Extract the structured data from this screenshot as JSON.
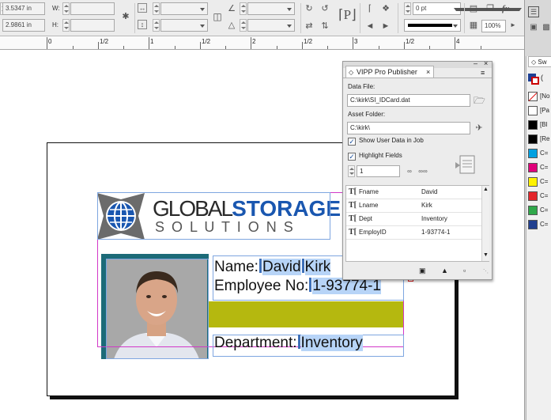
{
  "control_bar": {
    "x_value": "3.5347 in",
    "y_value": "2.9861 in",
    "w_label": "W:",
    "h_label": "H:",
    "stroke_weight": "0 pt",
    "zoom": "100%"
  },
  "ruler": {
    "labels": [
      "0",
      "1/2",
      "1",
      "1/2",
      "2",
      "1/2",
      "3",
      "1/2",
      "4"
    ]
  },
  "id_card": {
    "logo_global": "GLOBAL",
    "logo_storage": "STORAGE",
    "logo_solutions": "S O L U T I O N S",
    "name_label": "Name:",
    "first_name": "David",
    "last_name": "Kirk",
    "employee_label": "Employee No:",
    "employee_no": "1-93774-1",
    "department_label": "Department:",
    "department": "Inventory"
  },
  "vipp_panel": {
    "tab_title": "VIPP Pro Publisher",
    "data_file_label": "Data File:",
    "data_file_value": "C:\\kirk\\SI_IDCard.dat",
    "asset_folder_label": "Asset Folder:",
    "asset_folder_value": "C:\\kirk\\",
    "show_user_data_label": "Show User Data in Job",
    "highlight_fields_label": "Highlight Fields",
    "record_number": "1",
    "fields": [
      {
        "name": "Fname",
        "value": "David"
      },
      {
        "name": "Lname",
        "value": "Kirk"
      },
      {
        "name": "Dept",
        "value": "Inventory"
      },
      {
        "name": "EmployID",
        "value": "1-93774-1"
      }
    ]
  },
  "swatches_panel": {
    "tab_title": "Sw",
    "items": [
      {
        "name": "[No",
        "color": "#ffffff"
      },
      {
        "name": "[Pa",
        "color": "#ffffff"
      },
      {
        "name": "[Bl",
        "color": "#000000"
      },
      {
        "name": "[Re",
        "color": "#000000"
      },
      {
        "name": "C=",
        "color": "#00a0e0"
      },
      {
        "name": "C=",
        "color": "#e0007a"
      },
      {
        "name": "C=",
        "color": "#fff200"
      },
      {
        "name": "C=",
        "color": "#e3262c"
      },
      {
        "name": "C=",
        "color": "#2fa84a"
      },
      {
        "name": "C=",
        "color": "#22408f"
      }
    ]
  },
  "colors": {
    "logo_blue": "#1a57b0",
    "band_color": "#b5b80f",
    "frame_blue": "#7ea6e0",
    "frame_magenta": "#d238c8"
  }
}
